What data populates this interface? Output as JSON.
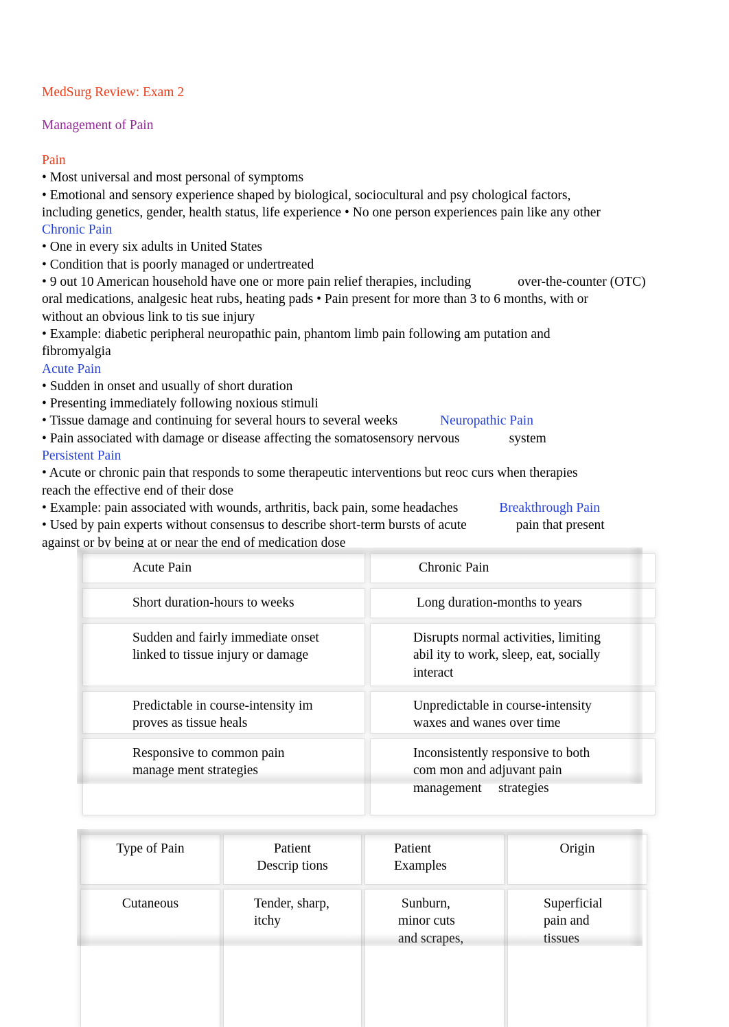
{
  "document": {
    "title": "MedSurg Review: Exam 2",
    "subtitle": "Management of Pain",
    "colors": {
      "title_red": "#ee3b17",
      "subtitle_purple": "#97269b",
      "heading_blue": "#2540d8",
      "body_black": "#000000"
    }
  },
  "sections": {
    "pain_heading": "Pain",
    "pain_bullets": "• Most universal and most personal of symptoms\n• Emotional and sensory experience shaped by biological, sociocultural and psy chological factors,\nincluding genetics, gender, health status, life experience • No one person experiences pain like any other",
    "chronic_heading": "Chronic Pain",
    "chronic_bullets_1": "• One in every six adults in United States\n• Condition that is poorly managed or undertreated\n• 9 out 10 American household have one or more pain relief therapies, including",
    "chronic_otc": "over-the-counter (OTC)",
    "chronic_bullets_2": "oral medications, analgesic heat rubs, heating pads • Pain present for more than 3 to 6 months, with or\nwithout an obvious link to tis sue injury\n• Example: diabetic peripheral neuropathic pain, phantom limb pain following am putation and\nfibromyalgia",
    "acute_heading": "Acute Pain",
    "acute_bullets_1": "• Sudden in onset and usually of short duration\n• Presenting immediately following noxious stimuli\n• Tissue damage and continuing for several hours to several weeks",
    "neuropathic_inline": "Neuropathic Pain",
    "acute_bullets_2": "• Pain associated with damage or disease affecting the somatosensory nervous",
    "acute_system_word": "system",
    "persistent_heading": "Persistent Pain",
    "persistent_bullets_1": "• Acute or chronic pain that responds to some therapeutic interventions but reoc curs when therapies\nreach the effective end of their dose\n• Example: pain associated with wounds, arthritis, back pain, some headaches",
    "breakthrough_inline": "Breakthrough Pain",
    "persistent_bullets_2": "• Used by pain experts without consensus to describe short-term bursts of acute",
    "breakthrough_tail": "pain that present",
    "persistent_bullets_3": "against or by being at or near the end of medication dose"
  },
  "table_acute_chronic": {
    "headers": [
      "Acute Pain",
      "Chronic Pain"
    ],
    "rows": [
      [
        "Short duration-hours to weeks",
        " Long duration-months to years"
      ],
      [
        "Sudden and fairly immediate onset\nlinked to tissue injury or damage",
        "Disrupts normal activities, limiting\nabil ity to work, sleep, eat, socially\ninteract"
      ],
      [
        "Predictable in course-intensity im\nproves as tissue heals",
        "Unpredictable in course-intensity\nwaxes and wanes over time"
      ],
      [
        "Responsive to common pain\nmanage ment strategies",
        "Inconsistently responsive to both\ncom mon and adjuvant pain\nmanagement     strategies"
      ]
    ]
  },
  "table_pain_types": {
    "headers": [
      "Type of Pain",
      "Patient\nDescrip tions",
      "Patient\nExamples",
      "Origin"
    ],
    "rows": [
      [
        "Cutaneous",
        "Tender, sharp,\nitchy",
        " Sunburn,\nminor cuts\nand scrapes,",
        "Superficial\npain and\ntissues"
      ]
    ]
  }
}
